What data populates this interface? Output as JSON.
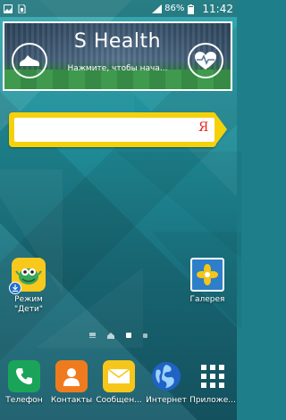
{
  "status_bar": {
    "battery_percent": "86%",
    "time": "11:42",
    "icons": [
      "gallery-notification-icon",
      "sim-icon",
      "signal-icon",
      "battery-icon"
    ]
  },
  "shealth_widget": {
    "title": "S Health",
    "subtitle": "Нажмите, чтобы нача...",
    "left_icon": "running-shoe-icon",
    "right_icon": "heart-rate-icon"
  },
  "search_widget": {
    "value": "",
    "logo": "Я"
  },
  "desktop": {
    "apps": [
      {
        "label": "Режим\n\"Дети\"",
        "icon": "kids-mode-icon"
      },
      {
        "label": "Галерея",
        "icon": "gallery-icon"
      }
    ]
  },
  "dock": {
    "apps": [
      {
        "label": "Телефон",
        "icon": "phone-icon"
      },
      {
        "label": "Контакты",
        "icon": "contacts-icon"
      },
      {
        "label": "Сообщен...",
        "icon": "messages-icon"
      },
      {
        "label": "Интернет",
        "icon": "internet-icon"
      },
      {
        "label": "Приложе...",
        "icon": "apps-grid-icon"
      }
    ]
  },
  "pager": {
    "pages": 4,
    "current": 3
  }
}
